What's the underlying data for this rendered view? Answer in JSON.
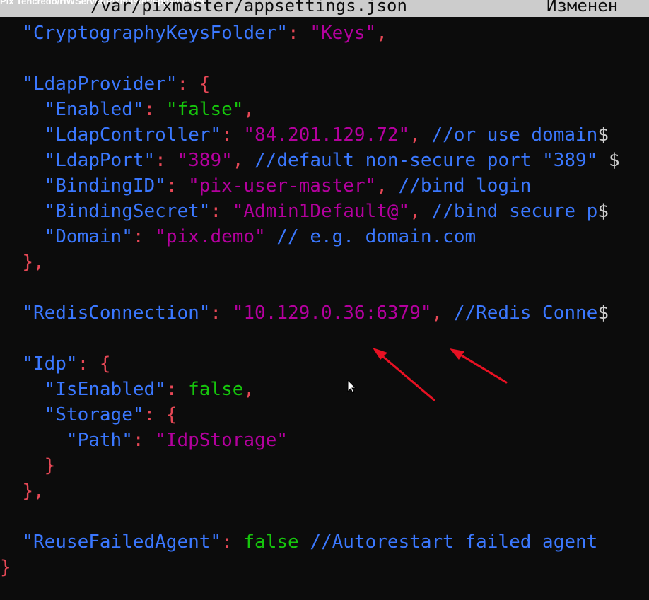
{
  "window": {
    "caption": "Pix Tehcredo/HWServer/Pixmaster/appsettings",
    "file_path": "/var/pixmaster/appsettings.json",
    "status": "Изменен"
  },
  "lines": [
    {
      "indent": "  ",
      "tokens": [
        {
          "t": "k",
          "v": "\"CryptographyKeysFolder\""
        },
        {
          "t": "p",
          "v": ": "
        },
        {
          "t": "s",
          "v": "\"Keys\""
        },
        {
          "t": "p",
          "v": ","
        }
      ]
    },
    {
      "indent": "",
      "tokens": []
    },
    {
      "indent": "  ",
      "tokens": [
        {
          "t": "k",
          "v": "\"LdapProvider\""
        },
        {
          "t": "p",
          "v": ": {"
        }
      ]
    },
    {
      "indent": "    ",
      "tokens": [
        {
          "t": "k",
          "v": "\"Enabled\""
        },
        {
          "t": "p",
          "v": ": "
        },
        {
          "t": "b",
          "v": "\"false\""
        },
        {
          "t": "p",
          "v": ","
        }
      ]
    },
    {
      "indent": "    ",
      "tokens": [
        {
          "t": "k",
          "v": "\"LdapController\""
        },
        {
          "t": "p",
          "v": ": "
        },
        {
          "t": "s",
          "v": "\"84.201.129.72\""
        },
        {
          "t": "p",
          "v": ", "
        },
        {
          "t": "c",
          "v": "//or use domain"
        },
        {
          "t": "cut",
          "v": "$"
        }
      ]
    },
    {
      "indent": "    ",
      "tokens": [
        {
          "t": "k",
          "v": "\"LdapPort\""
        },
        {
          "t": "p",
          "v": ": "
        },
        {
          "t": "s",
          "v": "\"389\""
        },
        {
          "t": "p",
          "v": ", "
        },
        {
          "t": "c",
          "v": "//default non-secure port \"389\""
        },
        {
          "t": "cut",
          "v": " $"
        }
      ]
    },
    {
      "indent": "    ",
      "tokens": [
        {
          "t": "k",
          "v": "\"BindingID\""
        },
        {
          "t": "p",
          "v": ": "
        },
        {
          "t": "s",
          "v": "\"pix-user-master\""
        },
        {
          "t": "p",
          "v": ", "
        },
        {
          "t": "c",
          "v": "//bind login"
        }
      ]
    },
    {
      "indent": "    ",
      "tokens": [
        {
          "t": "k",
          "v": "\"BindingSecret\""
        },
        {
          "t": "p",
          "v": ": "
        },
        {
          "t": "s",
          "v": "\"Admin1Default@\""
        },
        {
          "t": "p",
          "v": ", "
        },
        {
          "t": "c",
          "v": "//bind secure p"
        },
        {
          "t": "cut",
          "v": "$"
        }
      ]
    },
    {
      "indent": "    ",
      "tokens": [
        {
          "t": "k",
          "v": "\"Domain\""
        },
        {
          "t": "p",
          "v": ": "
        },
        {
          "t": "s",
          "v": "\"pix.demo\""
        },
        {
          "t": "p",
          "v": " "
        },
        {
          "t": "c",
          "v": "// e.g. domain.com"
        }
      ]
    },
    {
      "indent": "  ",
      "tokens": [
        {
          "t": "p",
          "v": "},"
        }
      ]
    },
    {
      "indent": "",
      "tokens": []
    },
    {
      "indent": "  ",
      "tokens": [
        {
          "t": "k",
          "v": "\"RedisConnection\""
        },
        {
          "t": "p",
          "v": ": "
        },
        {
          "t": "s",
          "v": "\"10.129.0.36:6379\""
        },
        {
          "t": "p",
          "v": ", "
        },
        {
          "t": "c",
          "v": "//Redis Conne"
        },
        {
          "t": "cut",
          "v": "$"
        }
      ]
    },
    {
      "indent": "",
      "tokens": []
    },
    {
      "indent": "  ",
      "tokens": [
        {
          "t": "k",
          "v": "\"Idp\""
        },
        {
          "t": "p",
          "v": ": {"
        }
      ]
    },
    {
      "indent": "    ",
      "tokens": [
        {
          "t": "k",
          "v": "\"IsEnabled\""
        },
        {
          "t": "p",
          "v": ": "
        },
        {
          "t": "l",
          "v": "false"
        },
        {
          "t": "p",
          "v": ","
        }
      ]
    },
    {
      "indent": "    ",
      "tokens": [
        {
          "t": "k",
          "v": "\"Storage\""
        },
        {
          "t": "p",
          "v": ": {"
        }
      ]
    },
    {
      "indent": "      ",
      "tokens": [
        {
          "t": "k",
          "v": "\"Path\""
        },
        {
          "t": "p",
          "v": ": "
        },
        {
          "t": "s",
          "v": "\"IdpStorage\""
        }
      ]
    },
    {
      "indent": "    ",
      "tokens": [
        {
          "t": "p",
          "v": "}"
        }
      ]
    },
    {
      "indent": "  ",
      "tokens": [
        {
          "t": "p",
          "v": "},"
        }
      ]
    },
    {
      "indent": "",
      "tokens": []
    },
    {
      "indent": "  ",
      "tokens": [
        {
          "t": "k",
          "v": "\"ReuseFailedAgent\""
        },
        {
          "t": "p",
          "v": ": "
        },
        {
          "t": "l",
          "v": "false"
        },
        {
          "t": "p",
          "v": " "
        },
        {
          "t": "c",
          "v": "//Autorestart failed agent"
        }
      ]
    },
    {
      "indent": "",
      "tokens": [
        {
          "t": "p",
          "v": "}"
        }
      ]
    }
  ],
  "colors": {
    "background": "#0c0c0c",
    "titlebar": "#cccccc",
    "key": "#3b78ff",
    "string": "#b4009e",
    "punctuation": "#e74856",
    "literal": "#16c60c",
    "annotation_arrow": "#e81123"
  },
  "icons": [
    "mouse-pointer-icon",
    "annotation-arrow-icon"
  ]
}
